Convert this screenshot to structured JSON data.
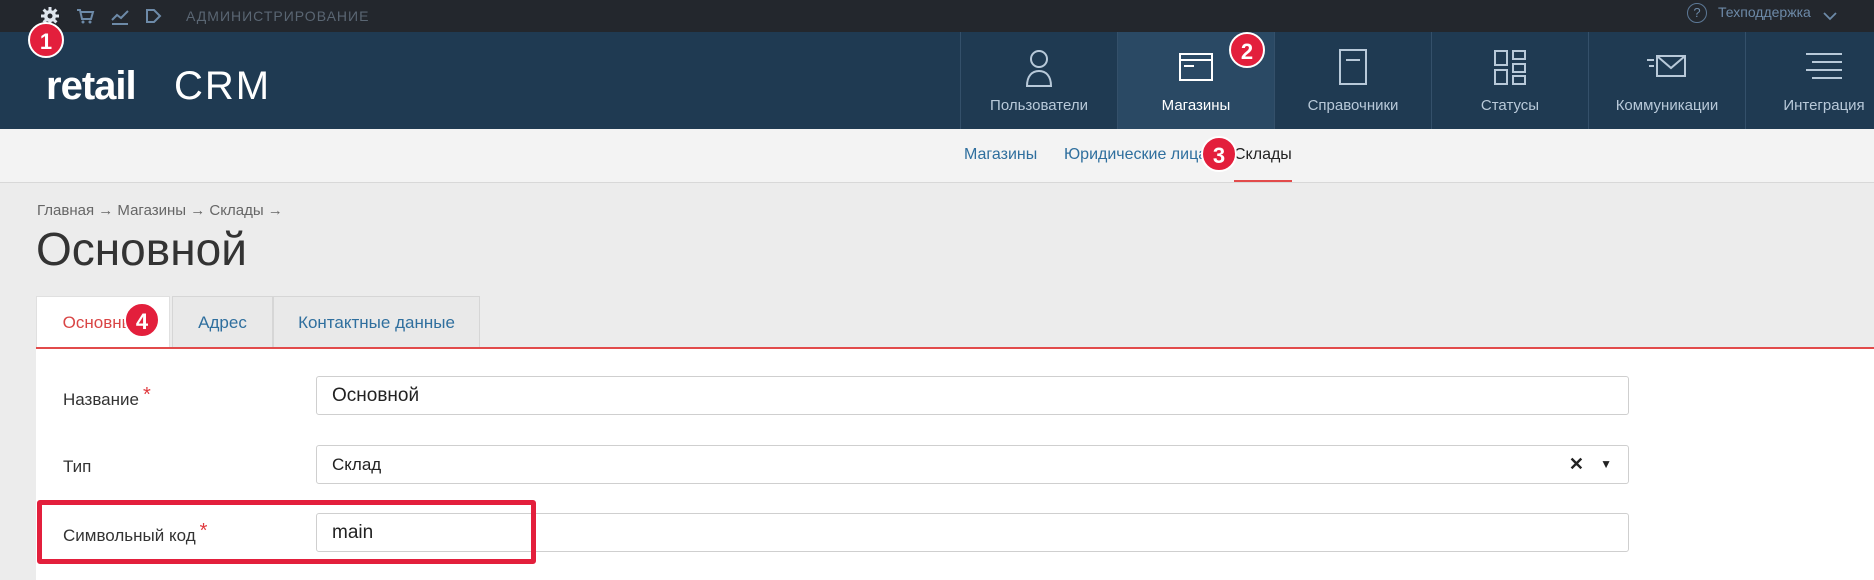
{
  "topbar": {
    "icons": [
      "gear-icon",
      "cart-icon",
      "chart-icon",
      "play-icon"
    ],
    "admin_label": "АДМИНИСТРИРОВАНИЕ",
    "support_label": "Техподдержка"
  },
  "header": {
    "logo_retail": "retail",
    "logo_crm": "CRM",
    "nav": [
      {
        "label": "Пользователи",
        "icon": "user-icon"
      },
      {
        "label": "Магазины",
        "icon": "store-window-icon"
      },
      {
        "label": "Справочники",
        "icon": "document-icon"
      },
      {
        "label": "Статусы",
        "icon": "grid-icon"
      },
      {
        "label": "Коммуникации",
        "icon": "mail-icon"
      },
      {
        "label": "Интеграция",
        "icon": "list-icon"
      }
    ]
  },
  "subnav": {
    "items": [
      "Магазины",
      "Юридические лица",
      "Склады"
    ]
  },
  "page": {
    "breadcrumb": "Главная → Магазины → Склады →",
    "title": "Основной",
    "tabs": [
      "Основные",
      "Адрес",
      "Контактные данные"
    ]
  },
  "form": {
    "name_label": "Название",
    "name_value": "Основной",
    "type_label": "Тип",
    "type_value": "Склад",
    "code_label": "Символьный код",
    "code_value": "main",
    "required_mark": "*"
  },
  "markers": [
    "1",
    "2",
    "3",
    "4"
  ],
  "colors": {
    "topbar": "#23272d",
    "header": "#1f3a52",
    "accent_red": "#e24b4b",
    "link_blue": "#2f6f9e",
    "marker_red": "#e31f3c"
  }
}
